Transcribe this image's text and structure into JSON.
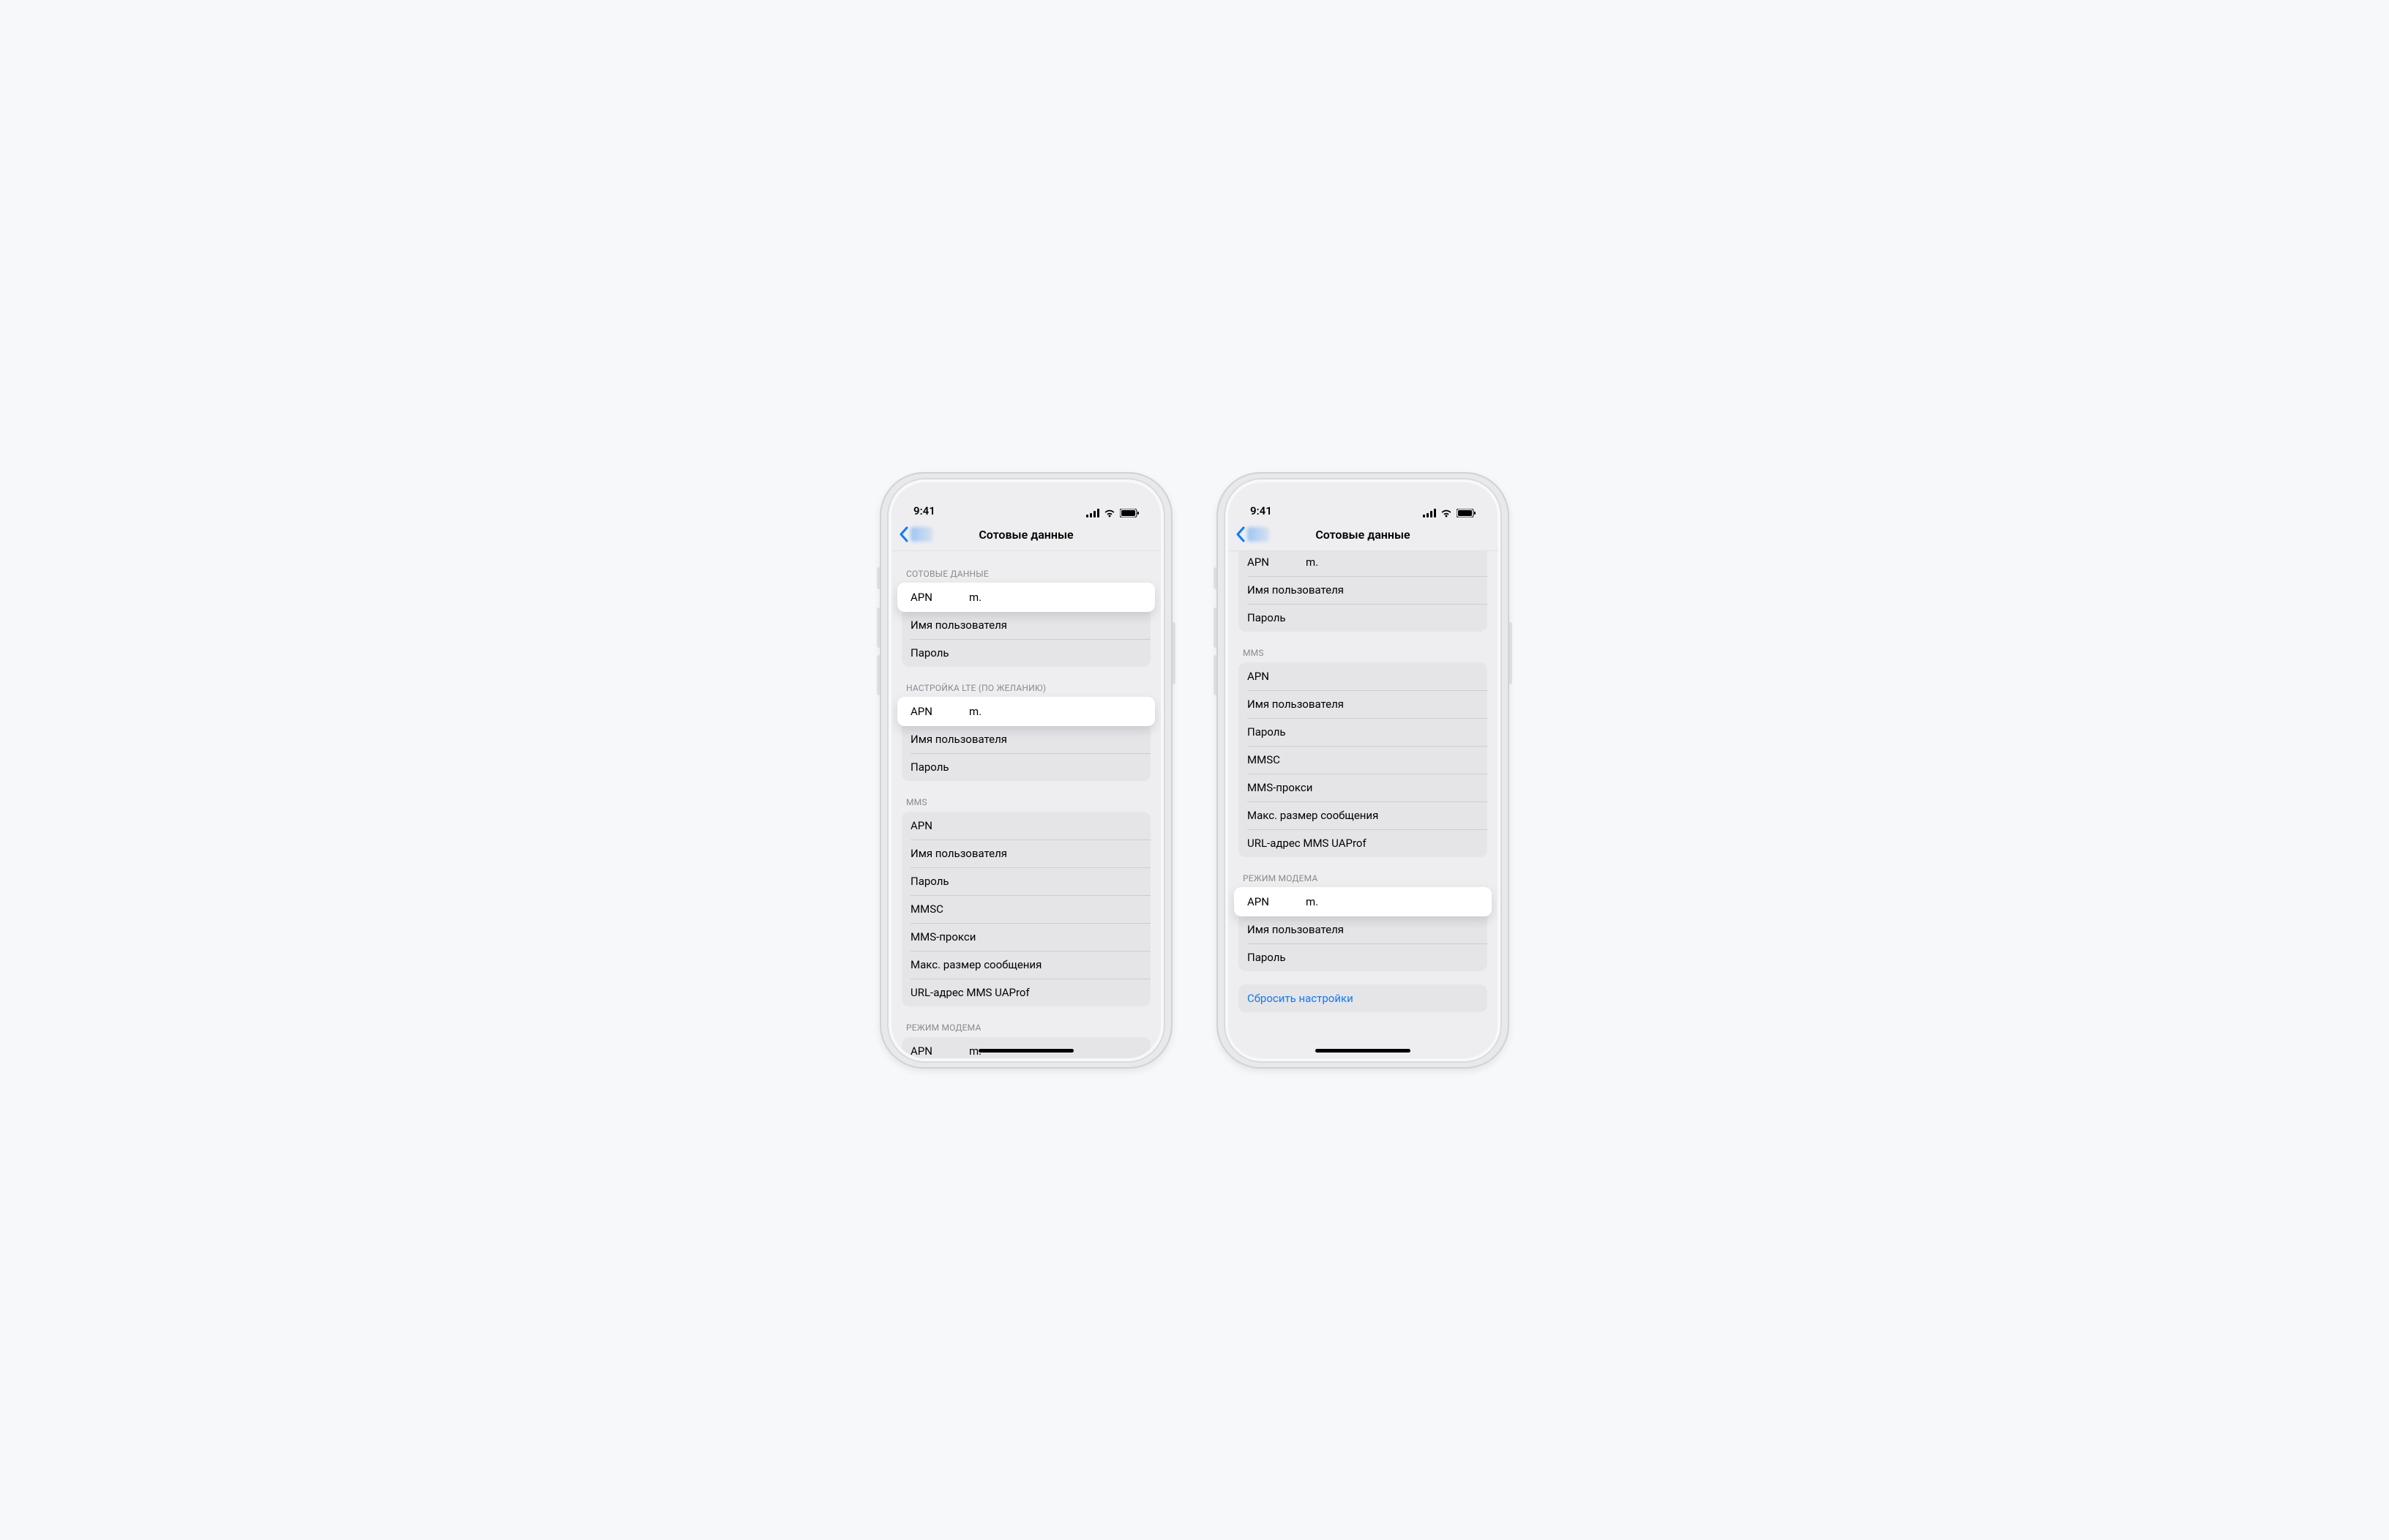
{
  "status": {
    "time": "9:41"
  },
  "nav": {
    "title": "Сотовые данные"
  },
  "sections": {
    "cellular": {
      "header": "СОТОВЫЕ ДАННЫЕ",
      "apn_label": "APN",
      "apn_value": "m.",
      "username_label": "Имя пользователя",
      "password_label": "Пароль"
    },
    "lte": {
      "header": "НАСТРОЙКА LTE (ПО ЖЕЛАНИЮ)",
      "apn_label": "APN",
      "apn_value": "m.",
      "username_label": "Имя пользователя",
      "password_label": "Пароль"
    },
    "mms": {
      "header": "MMS",
      "apn_label": "APN",
      "username_label": "Имя пользователя",
      "password_label": "Пароль",
      "mmsc_label": "MMSC",
      "proxy_label": "MMS-прокси",
      "maxsize_label": "Макс. размер сообщения",
      "uaprof_label": "URL-адрес MMS UAProf"
    },
    "hotspot": {
      "header": "РЕЖИМ МОДЕМА",
      "apn_label": "APN",
      "apn_value": "m.",
      "username_label": "Имя пользователя",
      "password_label": "Пароль"
    }
  },
  "reset": {
    "label": "Сбросить настройки"
  },
  "colors": {
    "accent": "#0a7bff"
  }
}
